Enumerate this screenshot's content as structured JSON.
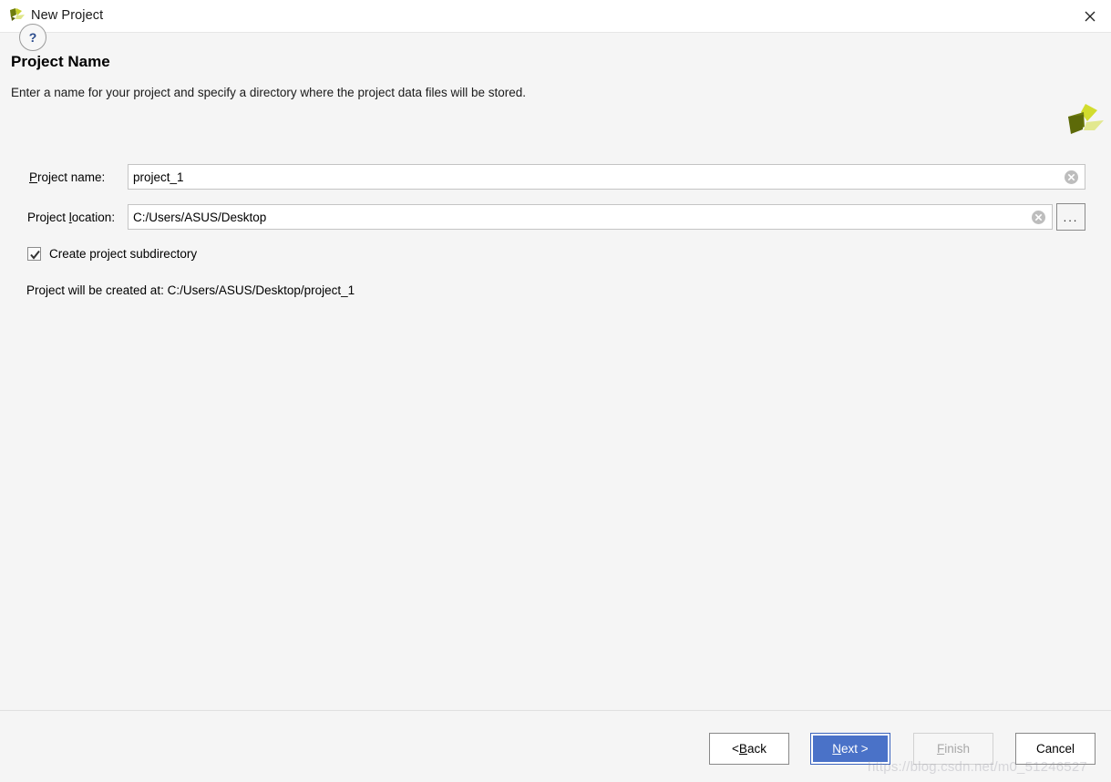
{
  "window": {
    "title": "New Project",
    "logo_icon": "app-leaf-logo",
    "close_icon": "close-icon"
  },
  "header": {
    "title": "Project Name",
    "subtitle": "Enter a name for your project and specify a directory where the project data files will be stored.",
    "logo_icon": "pinwheel-logo"
  },
  "form": {
    "name_field": {
      "label_pre": "",
      "label_mnemonic": "P",
      "label_post": "roject name:",
      "value": "project_1",
      "placeholder": "",
      "clear_icon": "clear-circle-icon"
    },
    "location_field": {
      "label_pre": "Project ",
      "label_mnemonic": "l",
      "label_post": "ocation:",
      "value": "C:/Users/ASUS/Desktop",
      "placeholder": "",
      "clear_icon": "clear-circle-icon",
      "browse_label": "..."
    },
    "subdirectory_checkbox": {
      "label": "Create project subdirectory",
      "checked": true
    },
    "info_text": "Project will be created at: C:/Users/ASUS/Desktop/project_1"
  },
  "footer": {
    "help_label": "?",
    "buttons": [
      {
        "name": "back",
        "pre": "< ",
        "mnemonic": "B",
        "post": "ack",
        "state": "enabled"
      },
      {
        "name": "next",
        "pre": "",
        "mnemonic": "N",
        "post": "ext >",
        "state": "default"
      },
      {
        "name": "finish",
        "pre": "",
        "mnemonic": "F",
        "post": "inish",
        "state": "disabled"
      },
      {
        "name": "cancel",
        "pre": "Cancel",
        "mnemonic": "",
        "post": "",
        "state": "enabled"
      }
    ]
  },
  "watermark": "https://blog.csdn.net/m0_51246527",
  "colors": {
    "background": "#f5f5f5",
    "titlebar": "#ffffff",
    "accent_button": "#4a72c8",
    "logo_dark": "#6f7d0c",
    "logo_mid": "#c6cf2a",
    "logo_light": "#dfe68a",
    "help_blue": "#2a4b8d",
    "disabled_text": "#a8a8a8"
  }
}
